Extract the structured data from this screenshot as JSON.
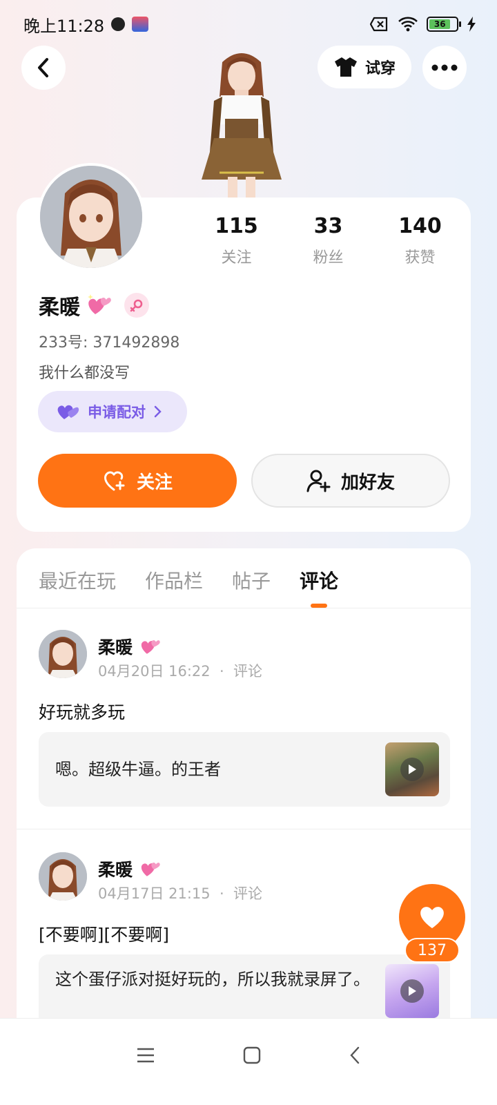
{
  "status_bar": {
    "time": "晚上11:28",
    "battery": "36"
  },
  "header": {
    "try_on_label": "试穿"
  },
  "profile": {
    "stats": [
      {
        "value": "115",
        "label": "关注"
      },
      {
        "value": "33",
        "label": "粉丝"
      },
      {
        "value": "140",
        "label": "获赞"
      }
    ],
    "name": "柔暖",
    "uid": "233号: 371492898",
    "bio": "我什么都没写",
    "pair_label": "申请配对",
    "follow_label": "关注",
    "add_friend_label": "加好友"
  },
  "tabs": [
    {
      "label": "最近在玩"
    },
    {
      "label": "作品栏"
    },
    {
      "label": "帖子"
    },
    {
      "label": "评论"
    }
  ],
  "posts": [
    {
      "name": "柔暖",
      "date": "04月20日 16:22",
      "type": "评论",
      "text": "好玩就多玩",
      "quote": "嗯。超级牛逼。的王者"
    },
    {
      "name": "柔暖",
      "date": "04月17日 21:15",
      "type": "评论",
      "text": "[不要啊][不要啊]",
      "quote": "这个蛋仔派对挺好玩的，所以我就录屏了。"
    }
  ],
  "like_count": "137",
  "colors": {
    "accent": "#ff7314",
    "pair": "#7a5ce6"
  }
}
